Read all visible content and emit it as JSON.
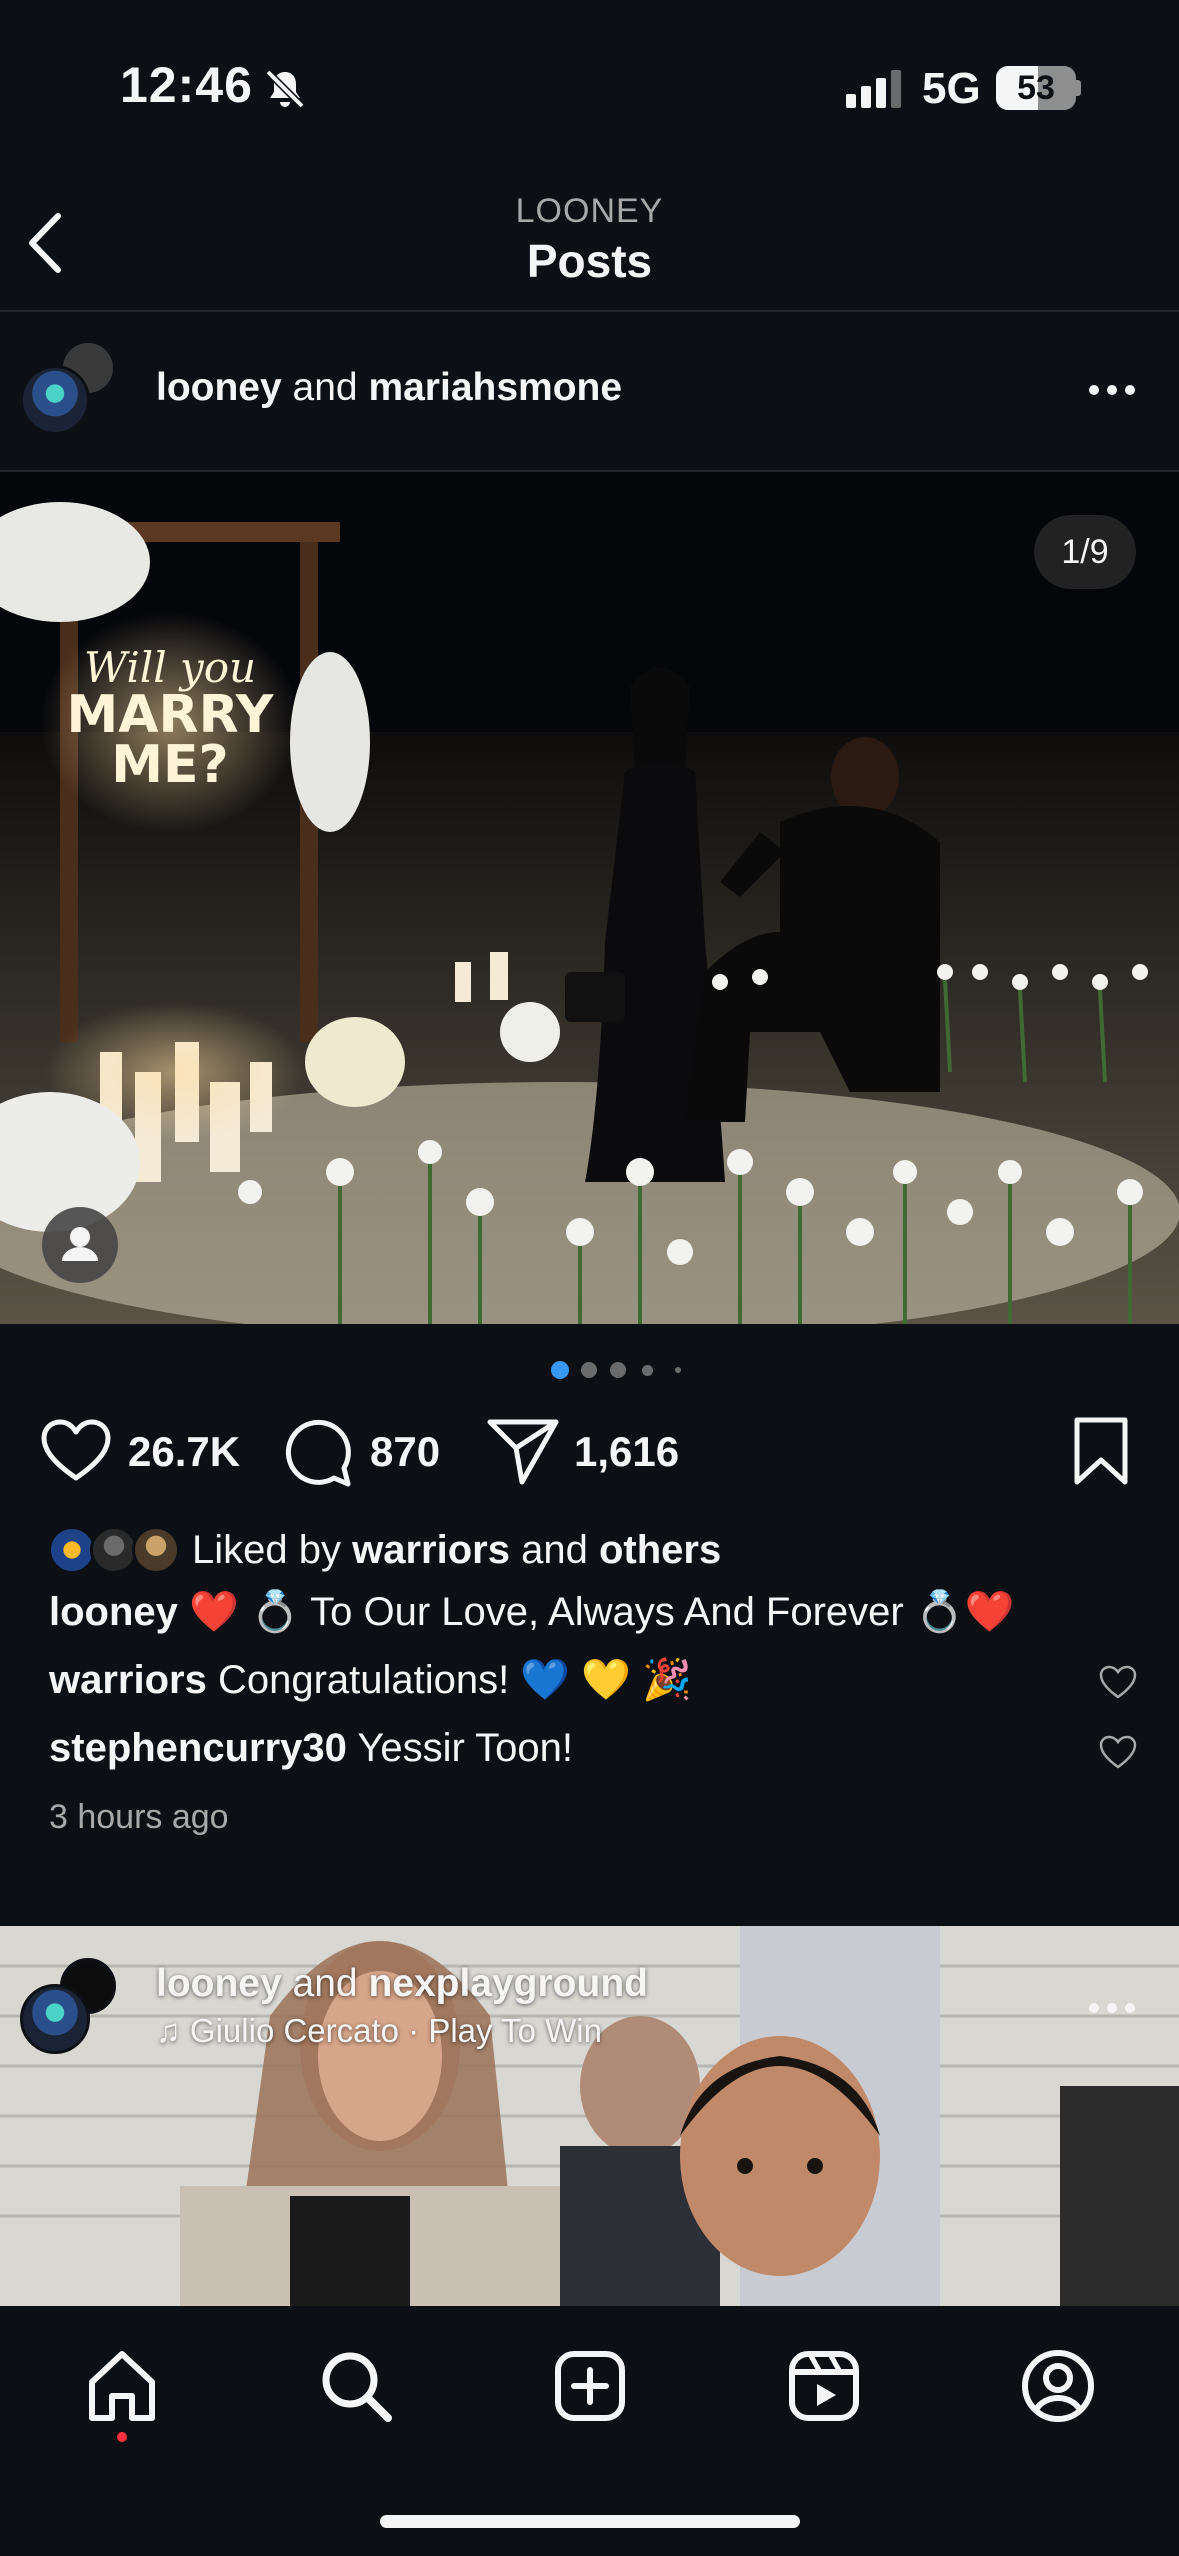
{
  "status_bar": {
    "time": "12:46",
    "network": "5G",
    "battery": "53",
    "battery_fraction": 0.53
  },
  "header": {
    "subtitle": "LOONEY",
    "title": "Posts"
  },
  "post1": {
    "author_primary": "looney",
    "author_joiner": " and ",
    "author_secondary": "mariahsmone",
    "image_counter": "1/9",
    "carousel_dots": 5,
    "carousel_active": 0,
    "like_count": "26.7K",
    "comment_count": "870",
    "share_count": "1,616",
    "liked_by": {
      "prefix": "Liked by ",
      "first": "warriors",
      "joiner": " and ",
      "others": "others"
    },
    "caption": {
      "username": "looney",
      "text": " ❤️ 💍 To Our Love, Always And Forever 💍❤️"
    },
    "comments": [
      {
        "username": "warriors",
        "text": " Congratulations! 💙 💛 🎉"
      },
      {
        "username": "stephencurry30",
        "text": " Yessir Toon!"
      }
    ],
    "timestamp": "3 hours ago",
    "sign_text": "Will you MARRY ME?"
  },
  "post2": {
    "author_primary": "looney",
    "author_joiner": " and ",
    "author_secondary": "nexplayground",
    "audio": "Giulio Cercato · Play To Win"
  },
  "tab_bar": {
    "items": [
      "home-icon",
      "search-icon",
      "create-icon",
      "reels-icon",
      "profile-icon"
    ],
    "active": "home"
  },
  "colors": {
    "background": "#0c1014",
    "text": "#f5f5f5",
    "secondary_text": "#a8a8a8",
    "accent_blue": "#3897f0",
    "notification_red": "#ff3040"
  }
}
